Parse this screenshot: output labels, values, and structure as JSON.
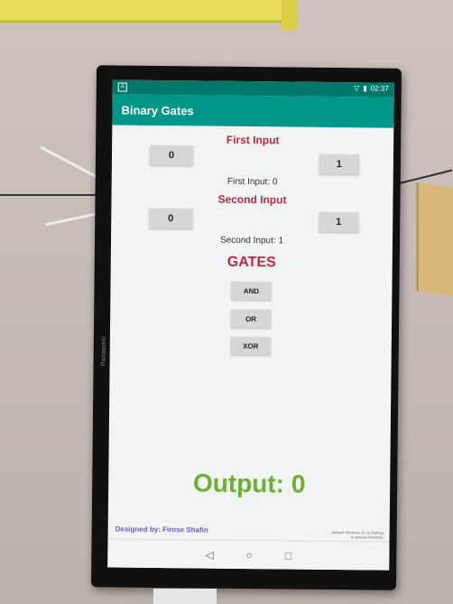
{
  "status_bar": {
    "time": "02:37",
    "notification_icon": "A"
  },
  "app": {
    "title": "Binary Gates"
  },
  "first_input": {
    "header": "First Input",
    "btn_zero": "0",
    "btn_one": "1",
    "status": "First Input: 0"
  },
  "second_input": {
    "header": "Second Input",
    "btn_zero": "0",
    "btn_one": "1",
    "status": "Second Input: 1"
  },
  "gates": {
    "header": "GATES",
    "and_label": "AND",
    "or_label": "OR",
    "xor_label": "XOR"
  },
  "output": {
    "text": "Output: 0"
  },
  "footer": {
    "credit": "Designed by: Firose Shafin",
    "watermark": "Activate Windows Go to Settings to activate Windows."
  },
  "monitor": {
    "brand": "Panasonic"
  },
  "nav": {
    "back": "◁",
    "home": "○",
    "recents": "□"
  },
  "colors": {
    "appbar": "#009688",
    "statusbar": "#00796b",
    "header_red": "#c2273b",
    "output_green": "#6bb032",
    "credit_purple": "#6a5acd"
  }
}
